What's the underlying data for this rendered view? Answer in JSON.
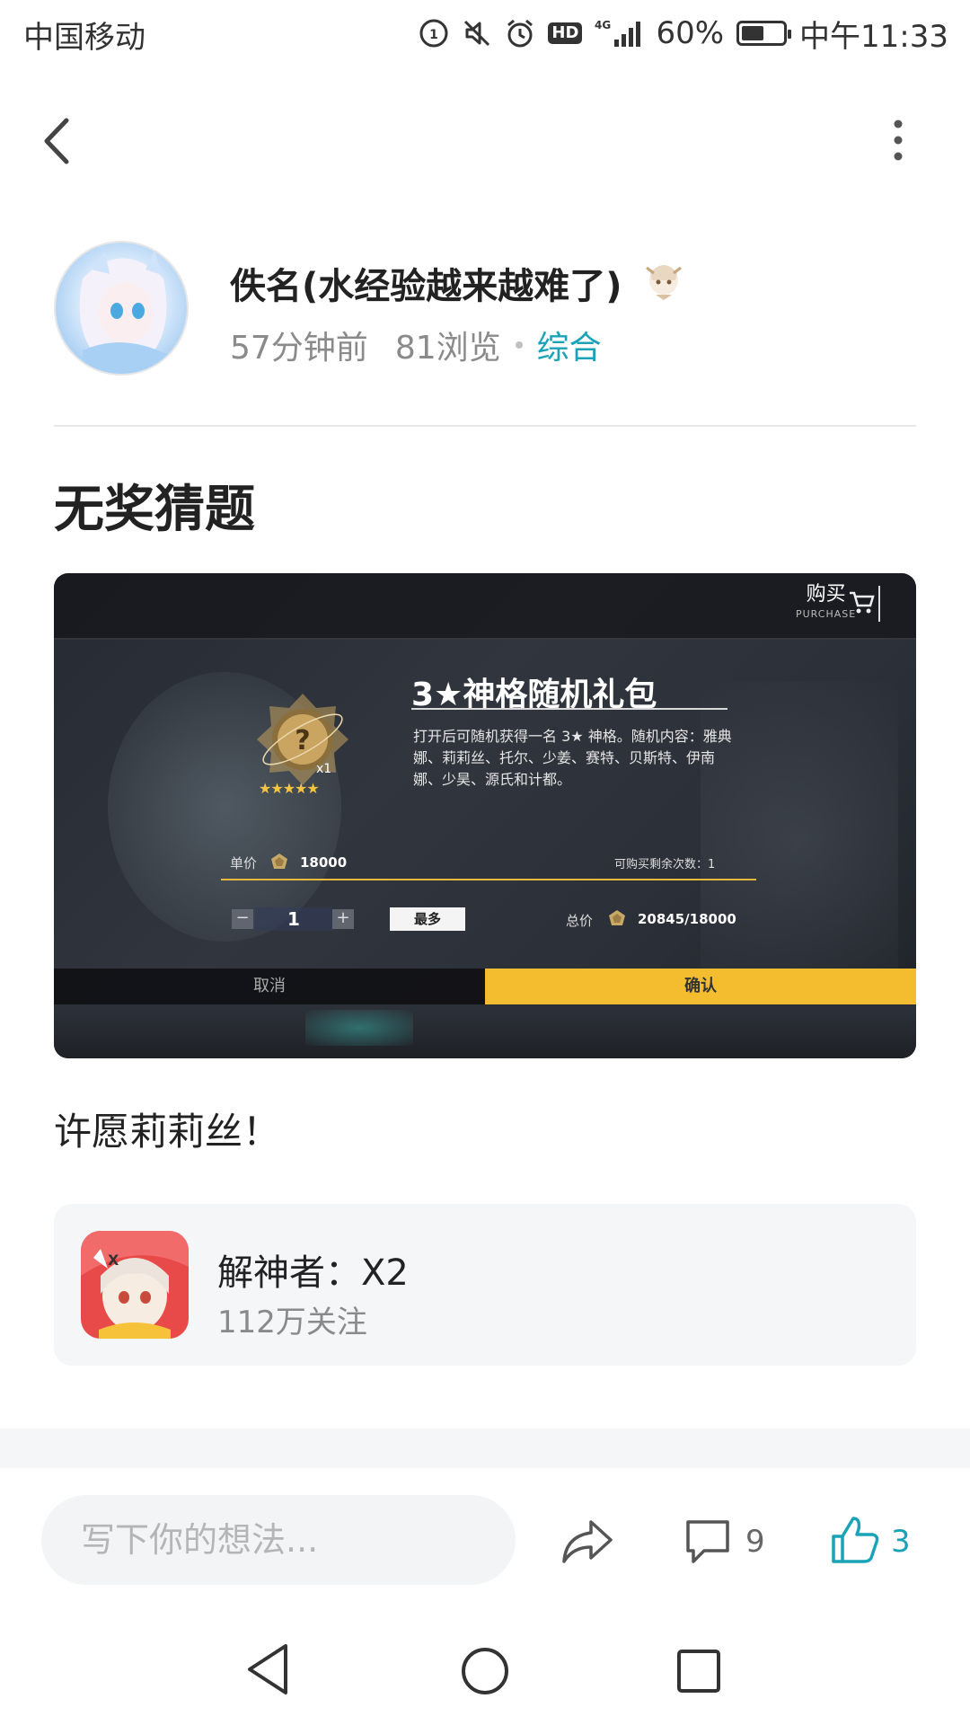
{
  "status_bar": {
    "carrier": "中国移动",
    "network": "4G",
    "hd": "HD",
    "battery": "60%",
    "battery_level": 0.6,
    "time": "中午11:33"
  },
  "author": {
    "name": "佚名(水经验越来越难了)",
    "time_ago": "57分钟前",
    "views": "81浏览",
    "category": "综合"
  },
  "post": {
    "title": "无奖猜题",
    "body": "许愿莉莉丝！",
    "image": {
      "purchase": "购买",
      "purchase_sub": "PURCHASE",
      "gift_title": "3★神格随机礼包",
      "gift_desc": "打开后可随机获得一名 3★ 神格。随机内容：雅典娜、莉莉丝、托尔、少姜、赛特、贝斯特、伊南娜、少昊、源氏和计都。",
      "medal_count": "x1",
      "medal_stars": "★★★★★",
      "unit_price_label": "单价",
      "unit_price": "18000",
      "remaining_label": "可购买剩余次数：1",
      "quantity": "1",
      "minus": "−",
      "plus": "+",
      "max_label": "最多",
      "total_label": "总价",
      "total_value": "20845/18000",
      "cancel": "取消",
      "confirm": "确认"
    }
  },
  "game_card": {
    "name": "解神者：X2",
    "followers": "112万关注"
  },
  "action_bar": {
    "comment_placeholder": "写下你的想法...",
    "comment_count": "9",
    "like_count": "3"
  },
  "colors": {
    "accent": "#1aa3b8",
    "confirm_yellow": "#f3bd2f"
  },
  "icons": [
    "back-icon",
    "more-icon",
    "share-icon",
    "comment-icon",
    "like-icon",
    "nav-back-icon",
    "nav-home-icon",
    "nav-recent-icon"
  ]
}
